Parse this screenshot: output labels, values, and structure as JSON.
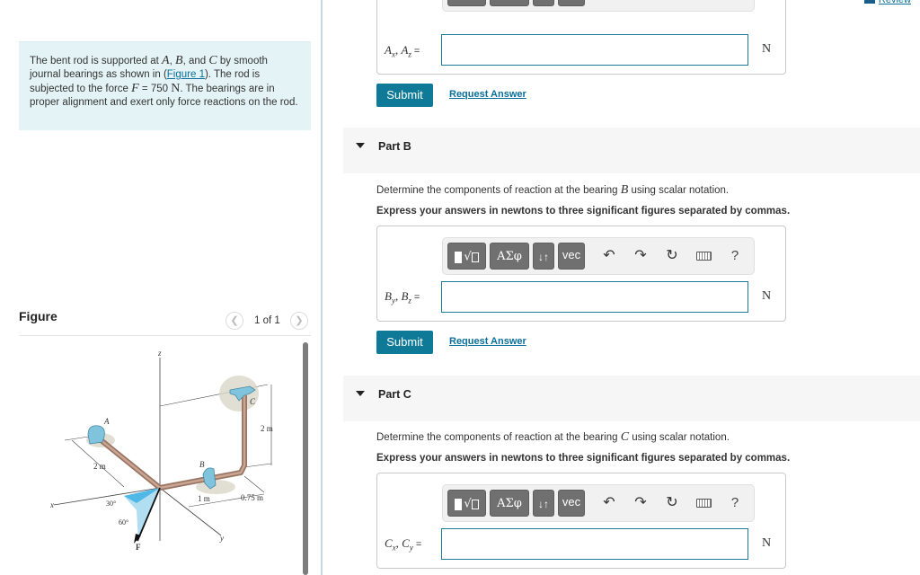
{
  "problem": {
    "text_1": "The bent rod is supported at ",
    "A": "A",
    "sep1": ", ",
    "B": "B",
    "sep2": ", and ",
    "C": "C",
    "text_2": " by smooth journal bearings as shown in (",
    "figure_link": "Figure 1",
    "text_3": "). The rod is subjected to the force ",
    "F": "F",
    "text_4": " = 750 ",
    "unit": "N",
    "text_5": ". The bearings are in proper alignment and exert only force reactions on the rod."
  },
  "figure": {
    "title": "Figure",
    "pager": "1 of 1",
    "prev_icon": "chevron-left-icon",
    "next_icon": "chevron-right-icon",
    "labels": {
      "z": "z",
      "x": "x",
      "y": "y",
      "A": "A",
      "B": "B",
      "C": "C",
      "F": "F",
      "dim_2m_a": "2 m",
      "dim_2m_c": "2 m",
      "dim_1m": "1 m",
      "dim_075m": "0.75 m",
      "angle_30": "30°",
      "angle_60": "60°"
    }
  },
  "header": {
    "review_label": "Review",
    "review_icon": "book-icon"
  },
  "toolbar": {
    "templates_icon": "fraction-root-template-icon",
    "greek_label": "ΑΣφ",
    "arrows_label": "↓↑",
    "vec_label": "vec",
    "undo_icon": "undo-icon",
    "redo_icon": "redo-icon",
    "reset_icon": "reset-icon",
    "keyboard_icon": "keyboard-icon",
    "help_label": "?"
  },
  "part_a": {
    "var_1": "A",
    "sub_1": "x",
    "var_2": "A",
    "sub_2": "z",
    "eq": "=",
    "value": "",
    "unit": "N",
    "submit_label": "Submit",
    "request_label": "Request Answer"
  },
  "part_b": {
    "title": "Part B",
    "instruction_pre": "Determine the components of reaction at the bearing ",
    "instruction_var": "B",
    "instruction_post": " using scalar notation.",
    "express": "Express your answers in newtons to three significant figures separated by commas.",
    "var_1": "B",
    "sub_1": "y",
    "var_2": "B",
    "sub_2": "z",
    "eq": "=",
    "value": "",
    "unit": "N",
    "submit_label": "Submit",
    "request_label": "Request Answer"
  },
  "part_c": {
    "title": "Part C",
    "instruction_pre": "Determine the components of reaction at the bearing ",
    "instruction_var": "C",
    "instruction_post": " using scalar notation.",
    "express": "Express your answers in newtons to three significant figures separated by commas.",
    "var_1": "C",
    "sub_1": "x",
    "var_2": "C",
    "sub_2": "y",
    "eq": "=",
    "value": "",
    "unit": "N"
  }
}
